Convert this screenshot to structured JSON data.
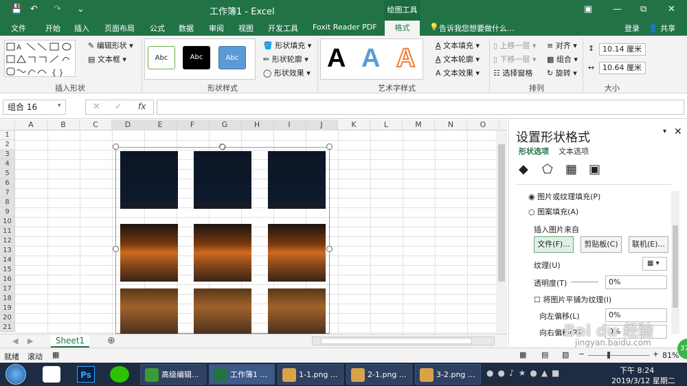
{
  "window": {
    "title": "工作簿1 - Excel",
    "context_tools": "绘图工具"
  },
  "tabs": [
    "文件",
    "开始",
    "插入",
    "页面布局",
    "公式",
    "数据",
    "审阅",
    "视图",
    "开发工具",
    "Foxit Reader PDF",
    "格式"
  ],
  "tell_me": "告诉我您想要做什么...",
  "account": {
    "login": "登录",
    "share": "共享"
  },
  "ribbon": {
    "insert_shapes": {
      "label": "插入形状",
      "edit_shape": "编辑形状",
      "textbox": "文本框"
    },
    "shape_styles": {
      "label": "形状样式",
      "samples": [
        "Abc",
        "Abc",
        "Abc"
      ],
      "fill": "形状填充",
      "outline": "形状轮廓",
      "effects": "形状效果"
    },
    "wordart": {
      "label": "艺术字样式",
      "samples": [
        "A",
        "A",
        "A"
      ],
      "text_fill": "文本填充",
      "text_outline": "文本轮廓",
      "text_effects": "文本效果"
    },
    "arrange": {
      "label": "排列",
      "bring_forward": "上移一层",
      "send_backward": "下移一层",
      "selection_pane": "选择窗格",
      "align": "对齐",
      "group": "组合",
      "rotate": "旋转"
    },
    "size": {
      "label": "大小",
      "height": "10.14 厘米",
      "width": "10.64 厘米"
    }
  },
  "formula_bar": {
    "name_box": "组合 16",
    "fx": "fx",
    "value": ""
  },
  "grid": {
    "columns": [
      "A",
      "B",
      "C",
      "D",
      "E",
      "F",
      "G",
      "H",
      "I",
      "J",
      "K",
      "L",
      "M",
      "N",
      "O"
    ],
    "rows": [
      "1",
      "2",
      "3",
      "4",
      "5",
      "6",
      "7",
      "8",
      "9",
      "10",
      "11",
      "12",
      "13",
      "14",
      "15",
      "16",
      "17",
      "18",
      "19",
      "20",
      "21"
    ]
  },
  "pane": {
    "title": "设置形状格式",
    "tabs": [
      "形状选项",
      "文本选项"
    ],
    "fill_options": [
      "图片或纹理填充(P)",
      "图案填充(A)"
    ],
    "insert_from": "插入图片来自",
    "buttons": [
      "文件(F)...",
      "剪贴板(C)",
      "联机(E)..."
    ],
    "texture": "纹理(U)",
    "transparency_label": "透明度(T)",
    "transparency_value": "0%",
    "tile_checkbox": "将图片平铺为纹理(I)",
    "offset_left_label": "向左偏移(L)",
    "offset_left_value": "0%",
    "offset_right_label": "向右偏移(R)",
    "offset_right_value": "0%"
  },
  "sheet_tab": "Sheet1",
  "status": {
    "ready": "就绪",
    "scroll": "滚动",
    "zoom": "81%"
  },
  "taskbar": {
    "items": [
      "高级编辑...",
      "工作簿1 ...",
      "1-1.png ...",
      "2-1.png ...",
      "3-2.png ..."
    ],
    "time": "下午 8:24",
    "date": "2019/3/12 星期二"
  },
  "watermark": {
    "brand": "Bai du 经验",
    "url": "jingyan.baidu.com"
  }
}
